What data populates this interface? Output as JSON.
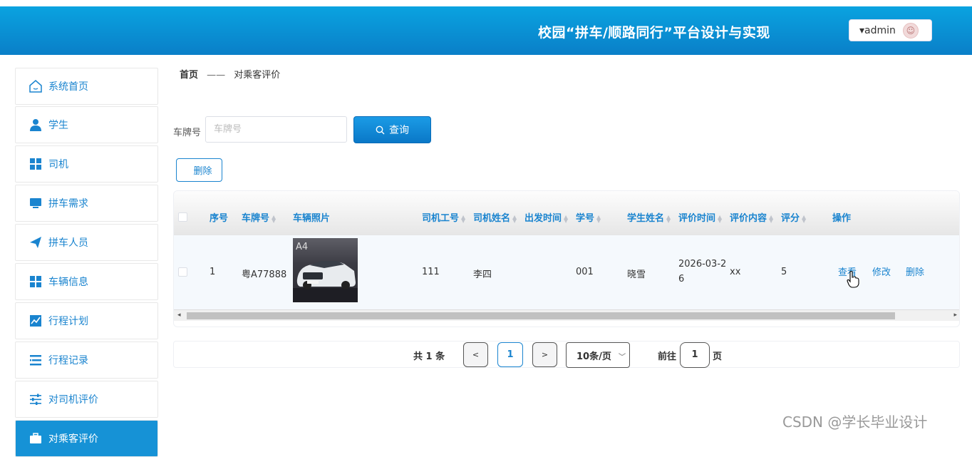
{
  "header": {
    "title": "校园“拼车/顺路同行”平台设计与实现",
    "user_label": "▾admin"
  },
  "sidebar": {
    "items": [
      {
        "label": "系统首页",
        "icon": "home-icon"
      },
      {
        "label": "学生",
        "icon": "user-icon"
      },
      {
        "label": "司机",
        "icon": "grid-icon"
      },
      {
        "label": "拼车需求",
        "icon": "monitor-icon"
      },
      {
        "label": "拼车人员",
        "icon": "paper-plane-icon"
      },
      {
        "label": "车辆信息",
        "icon": "grid-icon"
      },
      {
        "label": "行程计划",
        "icon": "chart-icon"
      },
      {
        "label": "行程记录",
        "icon": "list-icon"
      },
      {
        "label": "对司机评价",
        "icon": "sliders-icon"
      },
      {
        "label": "对乘客评价",
        "icon": "briefcase-icon"
      }
    ]
  },
  "breadcrumb": {
    "home": "首页",
    "separator": "——",
    "current": "对乘客评价"
  },
  "search": {
    "label": "车牌号",
    "placeholder": "车牌号",
    "button_label": "查询"
  },
  "toolbar": {
    "delete_label": "删除"
  },
  "table": {
    "columns": [
      "序号",
      "车牌号",
      "车辆照片",
      "司机工号",
      "司机姓名",
      "出发时间",
      "学号",
      "学生姓名",
      "评价时间",
      "评价内容",
      "评分",
      "操作"
    ],
    "rows": [
      {
        "index": "1",
        "plate": "粤A77888",
        "driver_id": "111",
        "driver_name": "李四",
        "depart_time": "",
        "student_id": "001",
        "student_name": "晓雪",
        "eval_time_line1": "2026-03-2",
        "eval_time_line2": "6",
        "content": "xx",
        "score": "5",
        "actions": {
          "view": "查看",
          "edit": "修改",
          "delete": "删除"
        }
      }
    ]
  },
  "pagination": {
    "total_prefix": "共",
    "total": "1",
    "total_suffix": "条",
    "prev": "<",
    "current_page": "1",
    "next": ">",
    "page_size": "10条/页",
    "goto_label": "前往",
    "goto_value": "1",
    "goto_suffix": "页"
  },
  "watermark": "CSDN @学长毕业设计",
  "colors": {
    "brand": "#0a8fd6",
    "link": "#1a84cf",
    "active_sidebar": "#1692d6"
  }
}
